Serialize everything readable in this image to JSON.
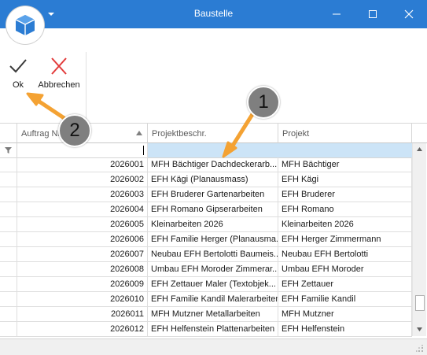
{
  "window": {
    "title": "Baustelle"
  },
  "ribbon": {
    "ok_label": "Ok",
    "cancel_label": "Abbrechen"
  },
  "grid": {
    "columns": [
      "Auftrag Nr",
      "Projektbeschr.",
      "Projekt"
    ],
    "rows": [
      {
        "auftrag": "2026001",
        "beschr": "MFH Bächtiger Dachdeckerarb...",
        "projekt": "MFH Bächtiger"
      },
      {
        "auftrag": "2026002",
        "beschr": "EFH Kägi (Planausmass)",
        "projekt": "EFH Kägi"
      },
      {
        "auftrag": "2026003",
        "beschr": "EFH Bruderer Gartenarbeiten",
        "projekt": "EFH Bruderer"
      },
      {
        "auftrag": "2026004",
        "beschr": "EFH Romano Gipserarbeiten",
        "projekt": "EFH Romano"
      },
      {
        "auftrag": "2026005",
        "beschr": "Kleinarbeiten 2026",
        "projekt": "Kleinarbeiten 2026"
      },
      {
        "auftrag": "2026006",
        "beschr": "EFH Familie Herger (Planausma...",
        "projekt": "EFH Herger Zimmermann"
      },
      {
        "auftrag": "2026007",
        "beschr": "Neubau EFH Bertolotti Baumeis...",
        "projekt": "Neubau EFH Bertolotti"
      },
      {
        "auftrag": "2026008",
        "beschr": "Umbau EFH Moroder Zimmerar...",
        "projekt": "Umbau EFH Moroder"
      },
      {
        "auftrag": "2026009",
        "beschr": "EFH Zettauer Maler (Textobjek...",
        "projekt": "EFH Zettauer"
      },
      {
        "auftrag": "2026010",
        "beschr": "EFH Familie Kandil Malerarbeiten",
        "projekt": "EFH Familie Kandil"
      },
      {
        "auftrag": "2026011",
        "beschr": "MFH Mutzner Metallarbeiten",
        "projekt": "MFH Mutzner"
      },
      {
        "auftrag": "2026012",
        "beschr": "EFH Helfenstein Plattenarbeiten",
        "projekt": "EFH Helfenstein"
      }
    ]
  },
  "callouts": {
    "one": "1",
    "two": "2"
  },
  "colors": {
    "titlebar": "#2b7cd3",
    "accent_orange": "#f4a233",
    "filter_highlight": "#cce4f7",
    "cancel_red": "#e23a3a"
  },
  "icons": [
    "app-cube-icon",
    "dropdown-caret-icon",
    "minimize-icon",
    "maximize-icon",
    "close-icon",
    "checkmark-icon",
    "cross-icon",
    "sort-ascending-icon",
    "filter-icon",
    "resize-grip-icon"
  ]
}
